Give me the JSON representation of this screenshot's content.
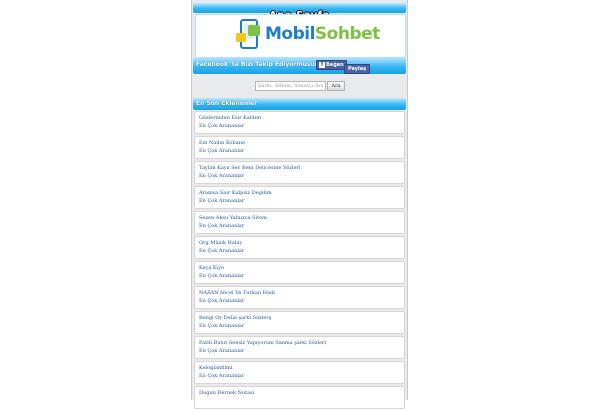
{
  "header": {
    "home_label": "Ana Sayfa",
    "logo": {
      "text_part1": "Mobil",
      "text_part2": "Sohbet",
      "colors": {
        "blue": "#1e7fc6",
        "green": "#7dc242"
      }
    }
  },
  "facebook_bar": {
    "text": "Facebook 'ta Bizi Takip Ediyormusunuz?",
    "like_label": "Beğen",
    "share_label": "Paylaş"
  },
  "search": {
    "placeholder": "Şarkı, Albüm, Sanatçı Ara",
    "button_label": "Ara"
  },
  "section": {
    "title": "En Son Eklenenler",
    "items": [
      {
        "title": "Gözlerinden Esir Kaldım",
        "sub": "En Çok Arananlar"
      },
      {
        "title": "Em Nadın Kobane",
        "sub": "En Çok Arananlar"
      },
      {
        "title": "Taylan Kaya Sev Beni Delicesine Sözleri",
        "sub": "En Çok Arananlar"
      },
      {
        "title": "Aramsa Sair Kalpsiz Degilim",
        "sub": "En Çok Arananlar"
      },
      {
        "title": "Sezen Aksu Yalnızca Sitem",
        "sub": "En Çok Arananlar"
      },
      {
        "title": "Org Müzik Halay",
        "sub": "En Çok Arananlar"
      },
      {
        "title": "Keça Kiyo",
        "sub": "En Çok Arananlar"
      },
      {
        "title": "NAZAN öncel Ve Turkan Hadi",
        "sub": "En Çok Arananlar"
      },
      {
        "title": "Bengi Oy Delal şarkı Sözlerş",
        "sub": "En Çok Arananlar"
      },
      {
        "title": "Fatih Bulut Sensiz Yapıyorum Sanma şarkı Sözleri",
        "sub": "En Çok Arananlar"
      },
      {
        "title": "Keloglanfilmi",
        "sub": "En Çok Arananlar"
      },
      {
        "title": "Dugun Dernek Notasi",
        "sub": ""
      }
    ]
  },
  "colors": {
    "accent": "#35b7f4",
    "link": "#1a56a6",
    "facebook": "#4a64a3"
  }
}
